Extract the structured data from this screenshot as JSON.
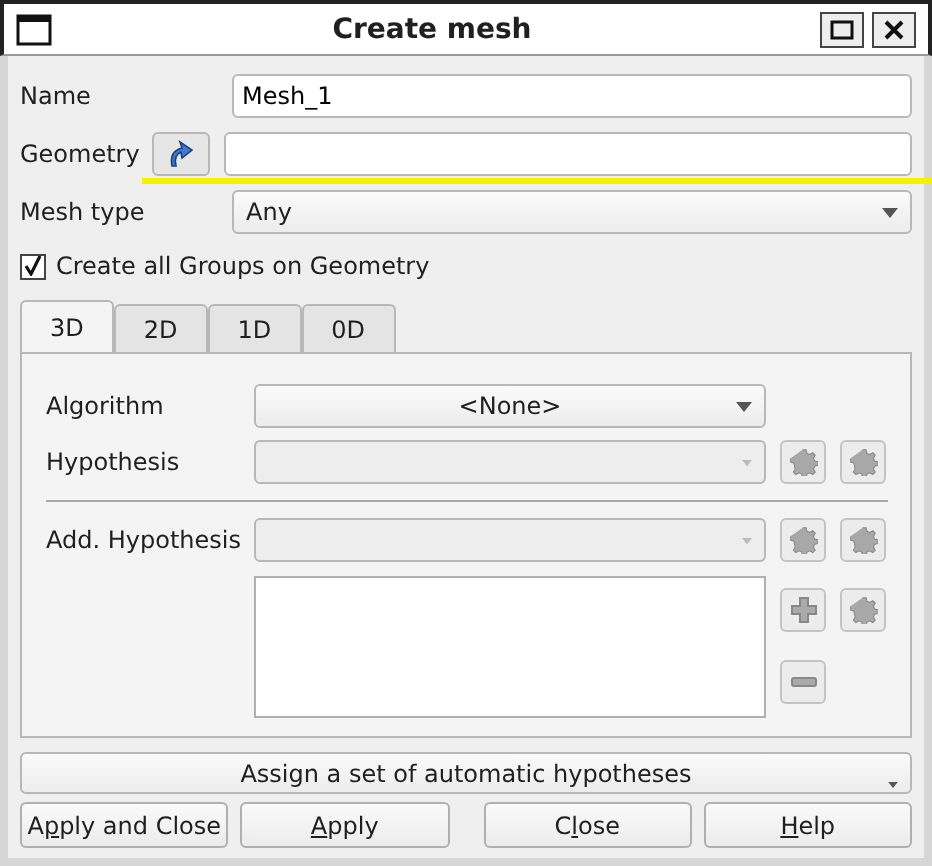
{
  "window": {
    "title": "Create mesh"
  },
  "name": {
    "label": "Name",
    "value": "Mesh_1"
  },
  "geometry": {
    "label": "Geometry"
  },
  "mesh_type": {
    "label": "Mesh type",
    "value": "Any"
  },
  "create_groups": {
    "label": "Create all Groups on Geometry",
    "checked": true
  },
  "tabs": [
    {
      "label": "3D",
      "selected": true
    },
    {
      "label": "2D",
      "selected": false
    },
    {
      "label": "1D",
      "selected": false
    },
    {
      "label": "0D",
      "selected": false
    }
  ],
  "algorithm": {
    "label": "Algorithm",
    "value": "<None>"
  },
  "hypothesis": {
    "label": "Hypothesis",
    "disabled": true
  },
  "add_hypothesis": {
    "label": "Add. Hypothesis",
    "disabled": true
  },
  "assign_button": "Assign a set of automatic hypotheses",
  "buttons": [
    {
      "before": "A",
      "underlined": "p",
      "after": "ply and Close"
    },
    {
      "underlined": "A",
      "after": "pply"
    },
    {
      "before": "C",
      "underlined": "l",
      "after": "ose"
    },
    {
      "underlined": "H",
      "after": "elp"
    }
  ]
}
